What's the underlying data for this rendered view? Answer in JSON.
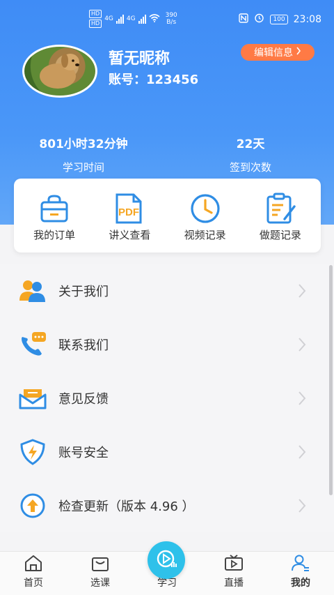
{
  "status": {
    "hd1": "HD",
    "hd2": "HD",
    "net1": "4G",
    "net2": "4G",
    "speed_value": "390",
    "speed_unit": "B/s",
    "battery": "100",
    "time": "23:08"
  },
  "profile": {
    "nickname": "暂无昵称",
    "account": "账号：123456",
    "edit_label": "编辑信息"
  },
  "stats": [
    {
      "value": "801小时32分钟",
      "label": "学习时间"
    },
    {
      "value": "22天",
      "label": "签到次数"
    }
  ],
  "quick": [
    {
      "label": "我的订单",
      "icon": "shopping-bag-icon"
    },
    {
      "label": "讲义查看",
      "icon": "pdf-document-icon"
    },
    {
      "label": "视频记录",
      "icon": "clock-icon"
    },
    {
      "label": "做题记录",
      "icon": "notepad-pen-icon"
    }
  ],
  "pdf_text": "PDF",
  "menu": [
    {
      "label": "关于我们",
      "icon": "people-icon"
    },
    {
      "label": "联系我们",
      "icon": "phone-chat-icon"
    },
    {
      "label": "意见反馈",
      "icon": "mail-feedback-icon"
    },
    {
      "label": "账号安全",
      "icon": "shield-lightning-icon"
    },
    {
      "label": "检查更新（版本 4.96 ）",
      "icon": "upload-arrow-icon"
    }
  ],
  "tabs": [
    {
      "label": "首页",
      "icon": "home-icon"
    },
    {
      "label": "选课",
      "icon": "basket-icon"
    },
    {
      "label": "学习",
      "icon": "play-circle-icon"
    },
    {
      "label": "直播",
      "icon": "tv-icon"
    },
    {
      "label": "我的",
      "icon": "user-icon"
    }
  ],
  "colors": {
    "header": "#4a97f8",
    "accent_orange": "#ff7a45",
    "icon_blue": "#2f8de4",
    "icon_orange": "#f5a623",
    "center_button": "#2ec1ea"
  }
}
